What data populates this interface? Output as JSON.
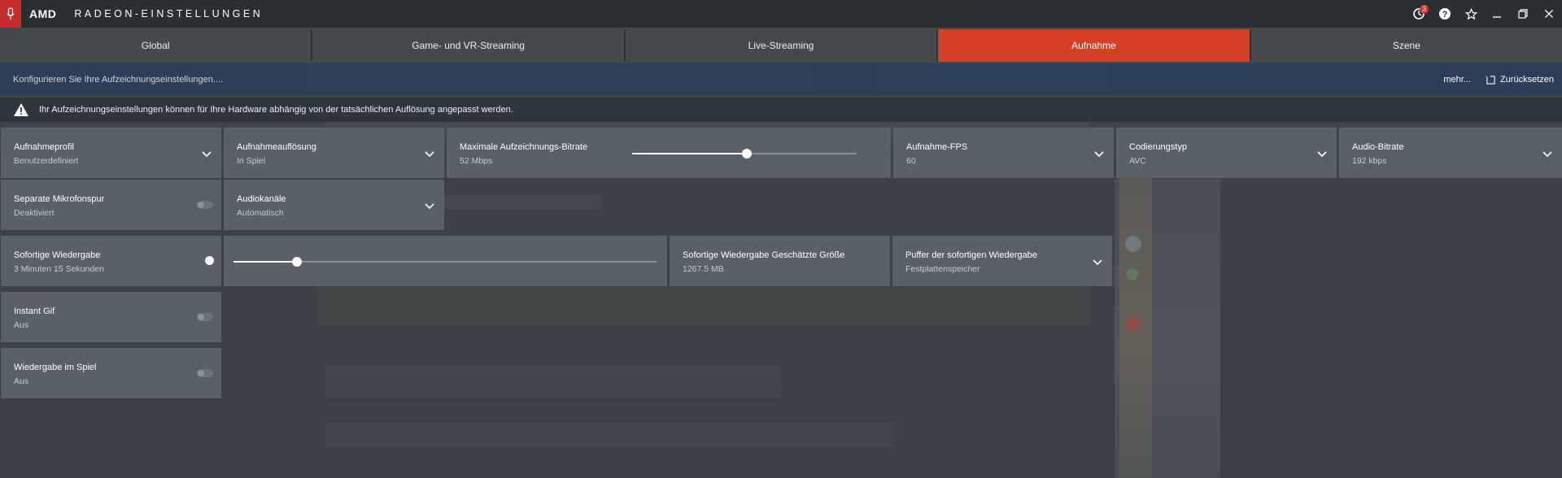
{
  "app": {
    "brand": "AMD",
    "title": "RADEON-EINSTELLUNGEN"
  },
  "titlebar": {
    "notification_count": "3",
    "icons": [
      "mic-icon",
      "notification-icon",
      "help-icon",
      "star-icon",
      "minimize-icon",
      "restore-icon",
      "close-icon"
    ]
  },
  "tabs": [
    {
      "label": "Global",
      "active": false
    },
    {
      "label": "Game- und VR-Streaming",
      "active": false
    },
    {
      "label": "Live-Streaming",
      "active": false
    },
    {
      "label": "Aufnahme",
      "active": true
    },
    {
      "label": "Szene",
      "active": false
    }
  ],
  "subheader": {
    "description": "Konfigurieren Sie Ihre Aufzeichnungseinstellungen....",
    "more_label": "mehr...",
    "reset_label": "Zurücksetzen"
  },
  "warning": {
    "text": "Ihr Aufzeichnungseinstellungen können für Ihre Hardware abhängig von der tatsächlichen Auflösung angepasst werden."
  },
  "settings": {
    "profile": {
      "label": "Aufnahmeprofil",
      "value": "Benutzerdefiniert"
    },
    "resolution": {
      "label": "Aufnahmeauflösung",
      "value": "In Spiel"
    },
    "bitrate": {
      "label": "Maximale Aufzeichnungs-Bitrate",
      "value": "52 Mbps",
      "slider_fraction": 0.51
    },
    "fps": {
      "label": "Aufnahme-FPS",
      "value": "60"
    },
    "encoding": {
      "label": "Codierungstyp",
      "value": "AVC"
    },
    "audio_bitrate": {
      "label": "Audio-Bitrate",
      "value": "192 kbps"
    },
    "mic_track": {
      "label": "Separate Mikrofonspur",
      "value": "Deaktiviert",
      "enabled": false
    },
    "audio_channels": {
      "label": "Audiokanäle",
      "value": "Automatisch"
    },
    "instant_replay": {
      "label": "Sofortige Wiedergabe",
      "value": "3 Minuten 15 Sekunden",
      "enabled": true,
      "slider_fraction": 0.15
    },
    "replay_size": {
      "label": "Sofortige Wiedergabe Geschätzte Größe",
      "value": "1267.5 MB"
    },
    "replay_buffer": {
      "label": "Puffer der sofortigen Wiedergabe",
      "value": "Festplattenspeicher"
    },
    "instant_gif": {
      "label": "Instant Gif",
      "value": "Aus",
      "enabled": false
    },
    "in_game_replay": {
      "label": "Wiedergabe im Spiel",
      "value": "Aus",
      "enabled": false
    }
  },
  "colors": {
    "accent": "#d43f25",
    "card": "#5a6068",
    "titlebar": "#2b2f33",
    "amd_red": "#c62d2d"
  }
}
